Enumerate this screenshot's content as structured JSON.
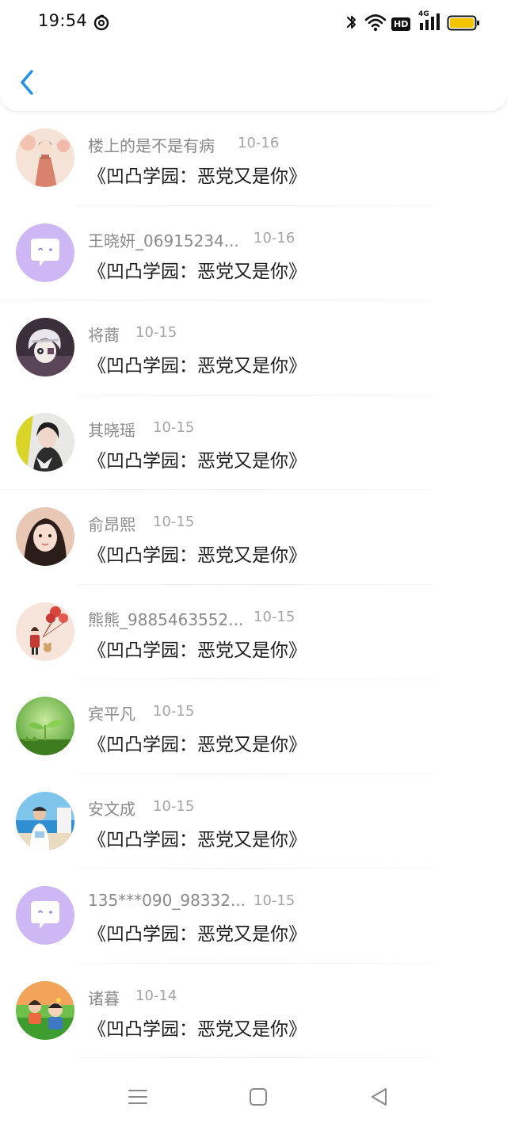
{
  "status_bar": {
    "time": "19:54",
    "left_icons": [
      "netease-music-icon"
    ],
    "right_icons": [
      "bluetooth-icon",
      "wifi-icon",
      "hd-icon",
      "4g-signal-icon",
      "battery-icon"
    ],
    "hd_label": "HD",
    "network_label": "4G",
    "battery_color": "#f5c400"
  },
  "header": {
    "back_icon": "chevron-left-icon",
    "accent_color": "#1e90e6"
  },
  "messages": [
    {
      "name": "楼上的是不是有病",
      "date": "10-16",
      "text": "《凹凸学园：恶党又是你》",
      "avatar": "anime-girl-avatar"
    },
    {
      "name": "王晓妍_06915234...",
      "date": "10-16",
      "text": "《凹凸学园：恶党又是你》",
      "avatar": "default-chat-avatar"
    },
    {
      "name": "将蔏",
      "date": "10-15",
      "text": "《凹凸学园：恶党又是你》",
      "avatar": "white-hair-anime-avatar"
    },
    {
      "name": "其晓瑶",
      "date": "10-15",
      "text": "《凹凸学园：恶党又是你》",
      "avatar": "girl-photo-avatar"
    },
    {
      "name": "俞昂熙",
      "date": "10-15",
      "text": "《凹凸学园：恶党又是你》",
      "avatar": "girl-portrait-avatar"
    },
    {
      "name": "熊熊_9885463552...",
      "date": "10-15",
      "text": "《凹凸学园：恶党又是你》",
      "avatar": "balloon-girl-avatar"
    },
    {
      "name": "宾平凡",
      "date": "10-15",
      "text": "《凹凸学园：恶党又是你》",
      "avatar": "green-sprout-avatar"
    },
    {
      "name": "安文成",
      "date": "10-15",
      "text": "《凹凸学园：恶党又是你》",
      "avatar": "beach-person-avatar"
    },
    {
      "name": "135***090_98332...",
      "date": "10-15",
      "text": "《凹凸学园：恶党又是你》",
      "avatar": "default-chat-avatar"
    },
    {
      "name": "诸暮",
      "date": "10-14",
      "text": "《凹凸学园：恶党又是你》",
      "avatar": "child-photo-avatar"
    }
  ],
  "nav_bar": {
    "icons": [
      "menu-icon",
      "home-square-icon",
      "back-triangle-icon"
    ]
  }
}
